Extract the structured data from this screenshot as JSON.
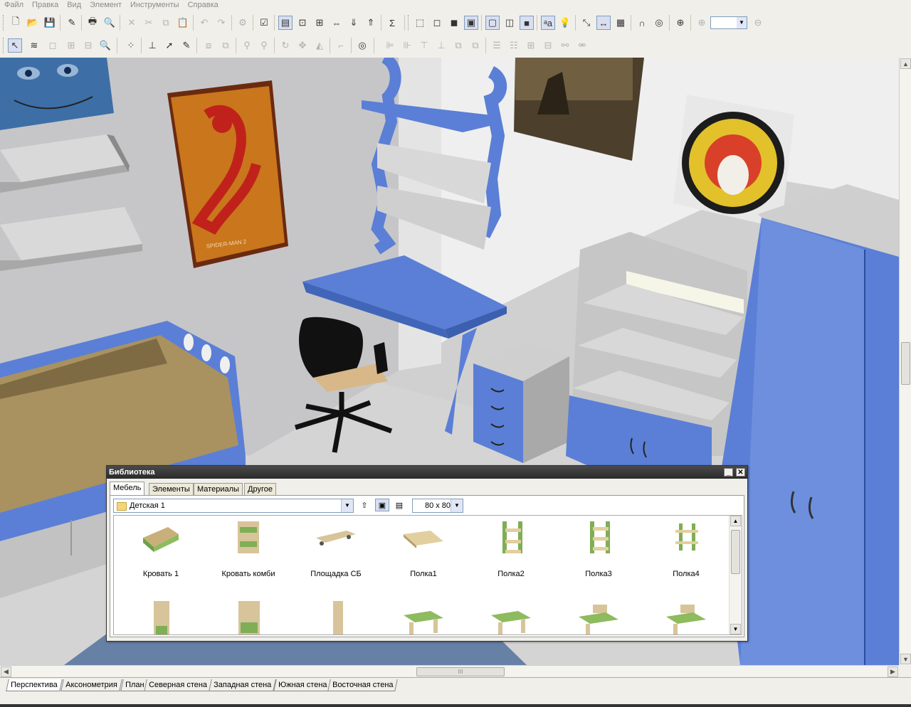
{
  "menu": [
    "Файл",
    "Правка",
    "Вид",
    "Элемент",
    "Инструменты",
    "Справка"
  ],
  "toolbar": {
    "zoom_value": "",
    "symbols": {
      "sum": "Σ",
      "text_tool": "ᵃa"
    }
  },
  "library": {
    "title": "Библиотека",
    "tabs": [
      "Мебель",
      "Элементы",
      "Материалы",
      "Другое"
    ],
    "active_tab": "Мебель",
    "folder": "Детская 1",
    "thumb_size": "80 x  80",
    "items": [
      "Кровать 1",
      "Кровать комби",
      "Площадка СБ",
      "Полка1",
      "Полка2",
      "Полка3",
      "Полка4"
    ]
  },
  "view_tabs": [
    "Перспектива",
    "Аксонометрия",
    "План",
    "Северная стена",
    "Западная стена",
    "Южная стена",
    "Восточная стена"
  ],
  "active_view": "Перспектива",
  "scene": {
    "poster_text": "SPIDER-MAN 2",
    "scroll_grip": "III"
  },
  "colors": {
    "furniture_blue": "#5b7fd6",
    "panel_gray": "#c8c8c8",
    "wall": "#ececec"
  }
}
